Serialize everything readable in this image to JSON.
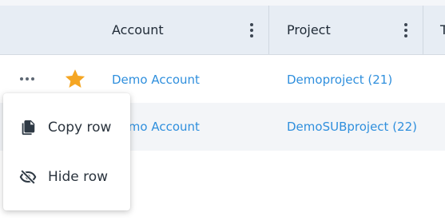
{
  "table": {
    "columns": [
      {
        "label": "Account"
      },
      {
        "label": "Project"
      },
      {
        "label": "T"
      }
    ],
    "rows": [
      {
        "account": "Demo Account",
        "project": "Demoproject (21)",
        "starred": true
      },
      {
        "account": "Demo Account",
        "project": "DemoSUBproject (22)",
        "starred": false
      }
    ]
  },
  "context_menu": {
    "items": [
      {
        "label": "Copy row",
        "icon": "copy-icon"
      },
      {
        "label": "Hide row",
        "icon": "eye-off-icon"
      }
    ]
  },
  "colors": {
    "header_bg": "#e7edf4",
    "link": "#2f8fdd",
    "star": "#f5a623",
    "row_alt_bg": "#f3f5f8"
  }
}
